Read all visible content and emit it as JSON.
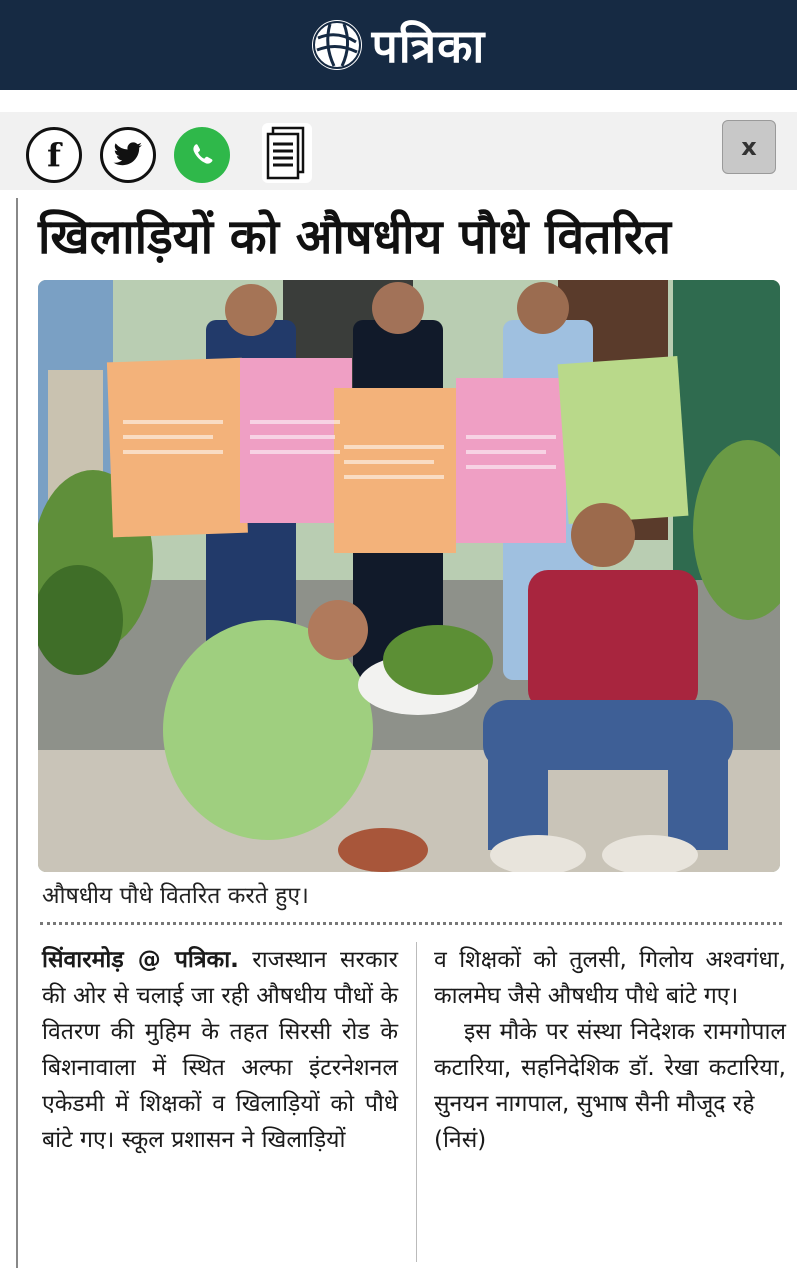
{
  "masthead": {
    "brand": "पत्रिका"
  },
  "share": {
    "facebook_icon": "facebook-icon",
    "twitter_icon": "twitter-icon",
    "whatsapp_icon": "whatsapp-icon",
    "document_icon": "document-icon",
    "close_label": "x"
  },
  "article": {
    "headline": "खिलाड़ियों को औषधीय पौधे वितरित",
    "caption": "औषधीय पौधे वितरित करते हुए।",
    "dateline": "सिंवारमोड़ @ पत्रिका.",
    "col1_text": "राजस्थान सरकार की ओर से चलाई जा रही औषधीय पौधों के वितरण की मुहिम के तहत सिरसी रोड के बिशनावाला में स्थित अल्फा इंटरनेशनल एकेडमी में शिक्षकों व खिलाड़ियों को पौधे बांटे गए। स्कूल प्रशासन ने खिलाड़ियों",
    "col2_para1": "व शिक्षकों को तुलसी, गिलोय अश्वगंधा, कालमेघ जैसे औषधीय पौधे बांटे गए।",
    "col2_para2": "इस मौके पर संस्था निदेशक रामगोपाल कटारिया, सहनिदेशिक डॉ. रेखा कटारिया, सुनयन नागपाल, सुभाष सैनी मौजूद रहे",
    "col2_tag": "(निसं)"
  },
  "colors": {
    "masthead_bg": "#162a43",
    "whatsapp_green": "#2fb84a",
    "wall_green": "#b9cdb2",
    "poster_orange": "#f3b27a",
    "poster_pink": "#ef9fc4",
    "poster_green": "#b9d98a"
  }
}
